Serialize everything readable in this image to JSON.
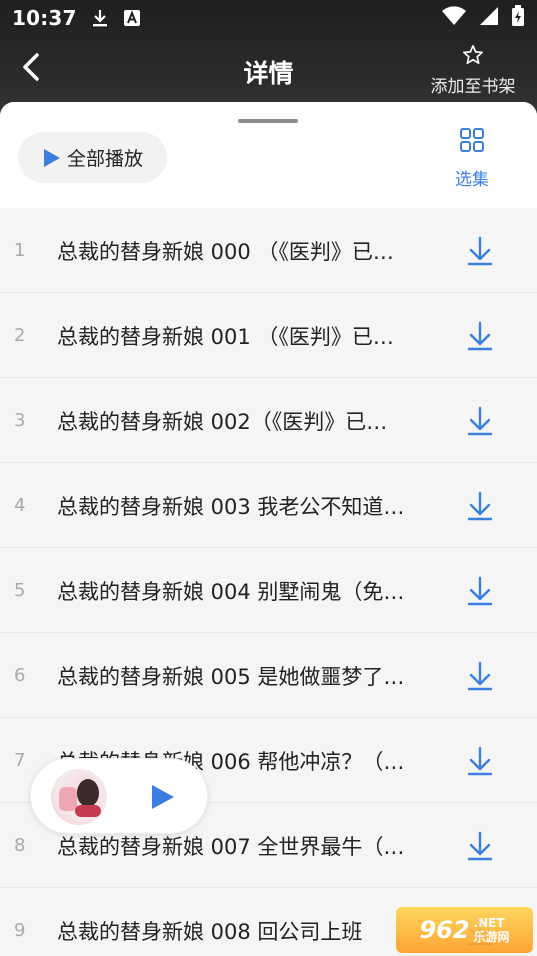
{
  "status_bar": {
    "time": "10:37"
  },
  "header": {
    "back_label": "<",
    "title": "详情",
    "favorite_label": "添加至书架"
  },
  "toolbar": {
    "play_all_label": "全部播放",
    "episodes_label": "选集"
  },
  "episodes": [
    {
      "index": "1",
      "title": "总裁的替身新娘 000 （《医判》已…"
    },
    {
      "index": "2",
      "title": "总裁的替身新娘 001 （《医判》已…"
    },
    {
      "index": "3",
      "title": "总裁的替身新娘 002（《医判》已…"
    },
    {
      "index": "4",
      "title": "总裁的替身新娘 003 我老公不知道…"
    },
    {
      "index": "5",
      "title": "总裁的替身新娘 004 别墅闹鬼（免…"
    },
    {
      "index": "6",
      "title": "总裁的替身新娘 005 是她做噩梦了…"
    },
    {
      "index": "7",
      "title": "总裁的替身新娘 006 帮他冲凉？（…"
    },
    {
      "index": "8",
      "title": "总裁的替身新娘 007 全世界最牛（…"
    },
    {
      "index": "9",
      "title": "总裁的替身新娘 008 回公司上班"
    }
  ],
  "watermark": {
    "text_main": "962",
    "text_sub": ".NET",
    "text_cn": "乐游网"
  },
  "colors": {
    "accent": "#3a7fe0",
    "header_bg": "#262626",
    "sheet_bg": "#f5f5f5"
  }
}
